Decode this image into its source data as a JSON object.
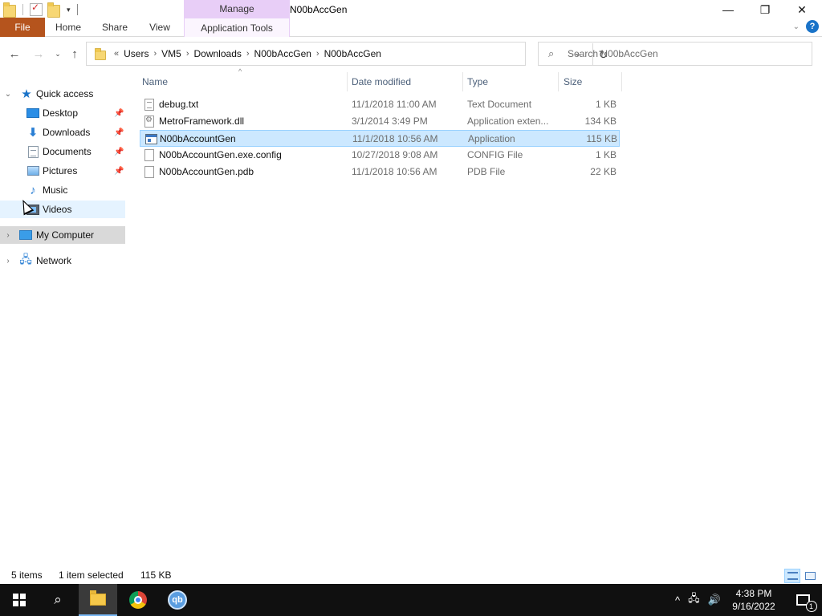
{
  "window": {
    "title": "N00bAccGen",
    "context_tab": "Manage",
    "controls": {
      "minimize": "—",
      "restore": "❐",
      "close": "✕"
    }
  },
  "ribbon": {
    "tabs": [
      {
        "label": "File"
      },
      {
        "label": "Home"
      },
      {
        "label": "Share"
      },
      {
        "label": "View"
      },
      {
        "label": "Application Tools"
      }
    ],
    "help": "?"
  },
  "address": {
    "overflow": "«",
    "crumbs": [
      "Users",
      "VM5",
      "Downloads",
      "N00bAccGen",
      "N00bAccGen"
    ]
  },
  "search": {
    "placeholder": "Search N00bAccGen"
  },
  "nav_pane": {
    "quick_access": "Quick access",
    "items": [
      {
        "label": "Desktop",
        "icon": "desktop-icon",
        "pinned": true
      },
      {
        "label": "Downloads",
        "icon": "download-icon",
        "pinned": true
      },
      {
        "label": "Documents",
        "icon": "documents-icon",
        "pinned": true
      },
      {
        "label": "Pictures",
        "icon": "pictures-icon",
        "pinned": true
      },
      {
        "label": "Music",
        "icon": "music-icon",
        "pinned": false
      },
      {
        "label": "Videos",
        "icon": "videos-icon",
        "pinned": false
      }
    ],
    "my_computer": "My Computer",
    "network": "Network"
  },
  "columns": {
    "name": "Name",
    "date": "Date modified",
    "type": "Type",
    "size": "Size"
  },
  "files": [
    {
      "name": "debug.txt",
      "date": "11/1/2018 11:00 AM",
      "type": "Text Document",
      "size": "1 KB",
      "icon": "text-file-icon",
      "selected": false
    },
    {
      "name": "MetroFramework.dll",
      "date": "3/1/2014 3:49 PM",
      "type": "Application exten...",
      "size": "134 KB",
      "icon": "dll-file-icon",
      "selected": false
    },
    {
      "name": "N00bAccountGen",
      "date": "11/1/2018 10:56 AM",
      "type": "Application",
      "size": "115 KB",
      "icon": "application-icon",
      "selected": true
    },
    {
      "name": "N00bAccountGen.exe.config",
      "date": "10/27/2018 9:08 AM",
      "type": "CONFIG File",
      "size": "1 KB",
      "icon": "blank-file-icon",
      "selected": false
    },
    {
      "name": "N00bAccountGen.pdb",
      "date": "11/1/2018 10:56 AM",
      "type": "PDB File",
      "size": "22 KB",
      "icon": "blank-file-icon",
      "selected": false
    }
  ],
  "status": {
    "items_count": "5 items",
    "selection": "1 item selected",
    "selection_size": "115 KB"
  },
  "taskbar": {
    "qb_label": "qb",
    "time": "4:38 PM",
    "date": "9/16/2022",
    "notifications": "1"
  },
  "colors": {
    "file_tab": "#b5541d",
    "manage_tab": "#e8cef7",
    "selection": "#cce8ff",
    "taskbar": "#101010"
  }
}
